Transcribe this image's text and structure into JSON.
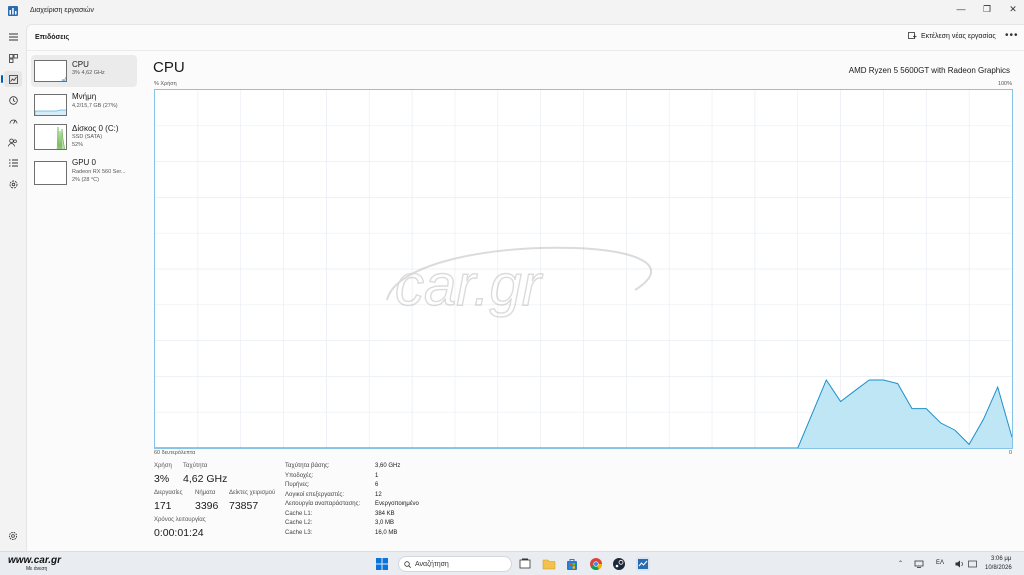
{
  "window": {
    "title": "Διαχείριση εργασιών",
    "controls": {
      "minimize": "—",
      "maximize": "❐",
      "close": "✕"
    }
  },
  "header": {
    "page_title": "Επιδόσεις",
    "run_task_label": "Εκτέλεση νέας εργασίας",
    "more_label": "•••"
  },
  "devices": [
    {
      "name": "CPU",
      "sub1": "3% 4,62 GHz",
      "sub2": "",
      "color": "#1e90c8",
      "usage": 0.03
    },
    {
      "name": "Μνήμη",
      "sub1": "4,2/15,7 GB (27%)",
      "sub2": "",
      "color": "#1e90c8",
      "usage": 0.27
    },
    {
      "name": "Δίσκος 0 (C:)",
      "sub1": "SSD (SATA)",
      "sub2": "52%",
      "color": "#4aa32d",
      "usage": 0.52
    },
    {
      "name": "GPU 0",
      "sub1": "Radeon RX 560 Ser...",
      "sub2": "2% (28 °C)",
      "color": "#1e90c8",
      "usage": 0.02
    }
  ],
  "cpu": {
    "title": "CPU",
    "model": "AMD Ryzen 5 5600GT with Radeon Graphics",
    "graph_y_label": "% Χρήση",
    "graph_y_max_label": "100%",
    "graph_x_left_label": "60 δευτερόλεπτα",
    "graph_x_right_label": "0",
    "watermark": "car.gr",
    "stats": {
      "usage_label": "Χρήση",
      "usage_value": "3%",
      "speed_label": "Ταχύτητα",
      "speed_value": "4,62 GHz",
      "processes_label": "Διεργασίες",
      "processes_value": "171",
      "threads_label": "Νήματα",
      "threads_value": "3396",
      "handles_label": "Δείκτες χειρισμού",
      "handles_value": "73857",
      "uptime_label": "Χρόνος λειτουργίας",
      "uptime_value": "0:00:01:24"
    },
    "specs": [
      {
        "key": "Ταχύτητα βάσης:",
        "value": "3,60 GHz"
      },
      {
        "key": "Υποδοχές:",
        "value": "1"
      },
      {
        "key": "Πυρήνες:",
        "value": "6"
      },
      {
        "key": "Λογικοί επεξεργαστές:",
        "value": "12"
      },
      {
        "key": "Λειτουργία αναπαράστασης:",
        "value": "Ενεργοποιημένο"
      },
      {
        "key": "Cache L1:",
        "value": "384 KB"
      },
      {
        "key": "Cache L2:",
        "value": "3,0 MB"
      },
      {
        "key": "Cache L3:",
        "value": "16,0 MB"
      }
    ]
  },
  "chart_data": {
    "type": "area",
    "title": "",
    "ylabel": "% Χρήση",
    "xlabel": "60 δευτερόλεπτα",
    "xlim": [
      60,
      0
    ],
    "ylim": [
      0,
      100
    ],
    "grid": true,
    "series": [
      {
        "color": "#bfe6f5",
        "x": [
          60,
          15,
          13,
          12,
          11,
          10,
          9,
          8,
          7,
          6,
          5,
          4,
          3,
          2,
          1,
          0
        ],
        "values": [
          0,
          0,
          19,
          13,
          16,
          19,
          19,
          18,
          11,
          11,
          7,
          5,
          1,
          8,
          17,
          3
        ]
      }
    ]
  },
  "taskbar": {
    "watermark_logo": "www.car.gr",
    "watermark_sub": "Με άνεση",
    "search_placeholder": "Αναζήτηση",
    "language": "ΕΛ",
    "time": "3:06 μμ",
    "date": "10/8/2026"
  }
}
